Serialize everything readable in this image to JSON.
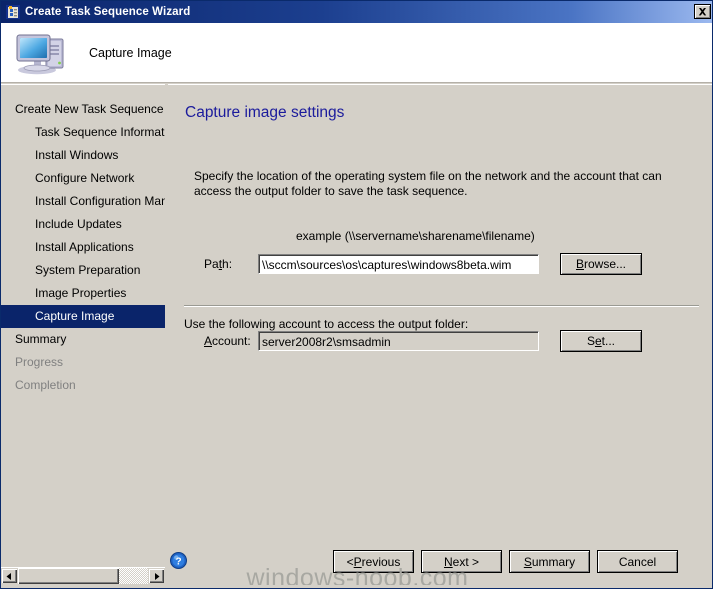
{
  "window": {
    "title": "Create Task Sequence Wizard",
    "titlebar_icon": "task-sequence-icon",
    "close_label": "✕",
    "accent_title_color": "#0a246a",
    "face_color": "#d4d0c8"
  },
  "header": {
    "icon": "computer-icon",
    "title": "Capture Image"
  },
  "sidebar": {
    "items": [
      {
        "label": "Create New Task Sequence",
        "level": 0,
        "state": "normal"
      },
      {
        "label": "Task Sequence Information",
        "level": 1,
        "state": "normal"
      },
      {
        "label": "Install Windows",
        "level": 1,
        "state": "normal"
      },
      {
        "label": "Configure Network",
        "level": 1,
        "state": "normal"
      },
      {
        "label": "Install Configuration Manag",
        "level": 1,
        "state": "normal"
      },
      {
        "label": "Include Updates",
        "level": 1,
        "state": "normal"
      },
      {
        "label": "Install Applications",
        "level": 1,
        "state": "normal"
      },
      {
        "label": "System Preparation",
        "level": 1,
        "state": "normal"
      },
      {
        "label": "Image Properties",
        "level": 1,
        "state": "normal"
      },
      {
        "label": "Capture Image",
        "level": 1,
        "state": "selected"
      },
      {
        "label": "Summary",
        "level": 0,
        "state": "normal"
      },
      {
        "label": "Progress",
        "level": 0,
        "state": "disabled"
      },
      {
        "label": "Completion",
        "level": 0,
        "state": "disabled"
      }
    ],
    "selected_color": "#0a246a",
    "disabled_color": "#808080",
    "scrollbar": {
      "left_arrow": "◄",
      "right_arrow": "►"
    }
  },
  "main": {
    "page_title": "Capture image settings",
    "page_title_color": "#1b1b9c",
    "description": "Specify the location of the operating system file on the network and the account that can access the output folder to save the task sequence.",
    "example_label": "example (\\\\servername\\sharename\\filename)",
    "path": {
      "label": "Path:",
      "label_accesskey": "t",
      "value": "\\\\sccm\\sources\\os\\captures\\windows8beta.wim",
      "browse_label": "Browse...",
      "browse_accesskey": "B",
      "readonly": false
    },
    "account": {
      "caption": "Use the following account to access the output folder:",
      "label": "Account:",
      "label_accesskey": "A",
      "value": "server2008r2\\smsadmin",
      "set_label": "Set...",
      "set_accesskey": "e",
      "readonly": true
    }
  },
  "footer": {
    "help_icon": "help-icon",
    "buttons": [
      {
        "label": "< Previous",
        "accesskey": "P"
      },
      {
        "label": "Next >",
        "accesskey": "N"
      },
      {
        "label": "Summary",
        "accesskey": "S"
      },
      {
        "label": "Cancel",
        "accesskey": ""
      }
    ]
  },
  "watermark": {
    "text": "windows-noob.com",
    "color": "#a8a8a2"
  }
}
